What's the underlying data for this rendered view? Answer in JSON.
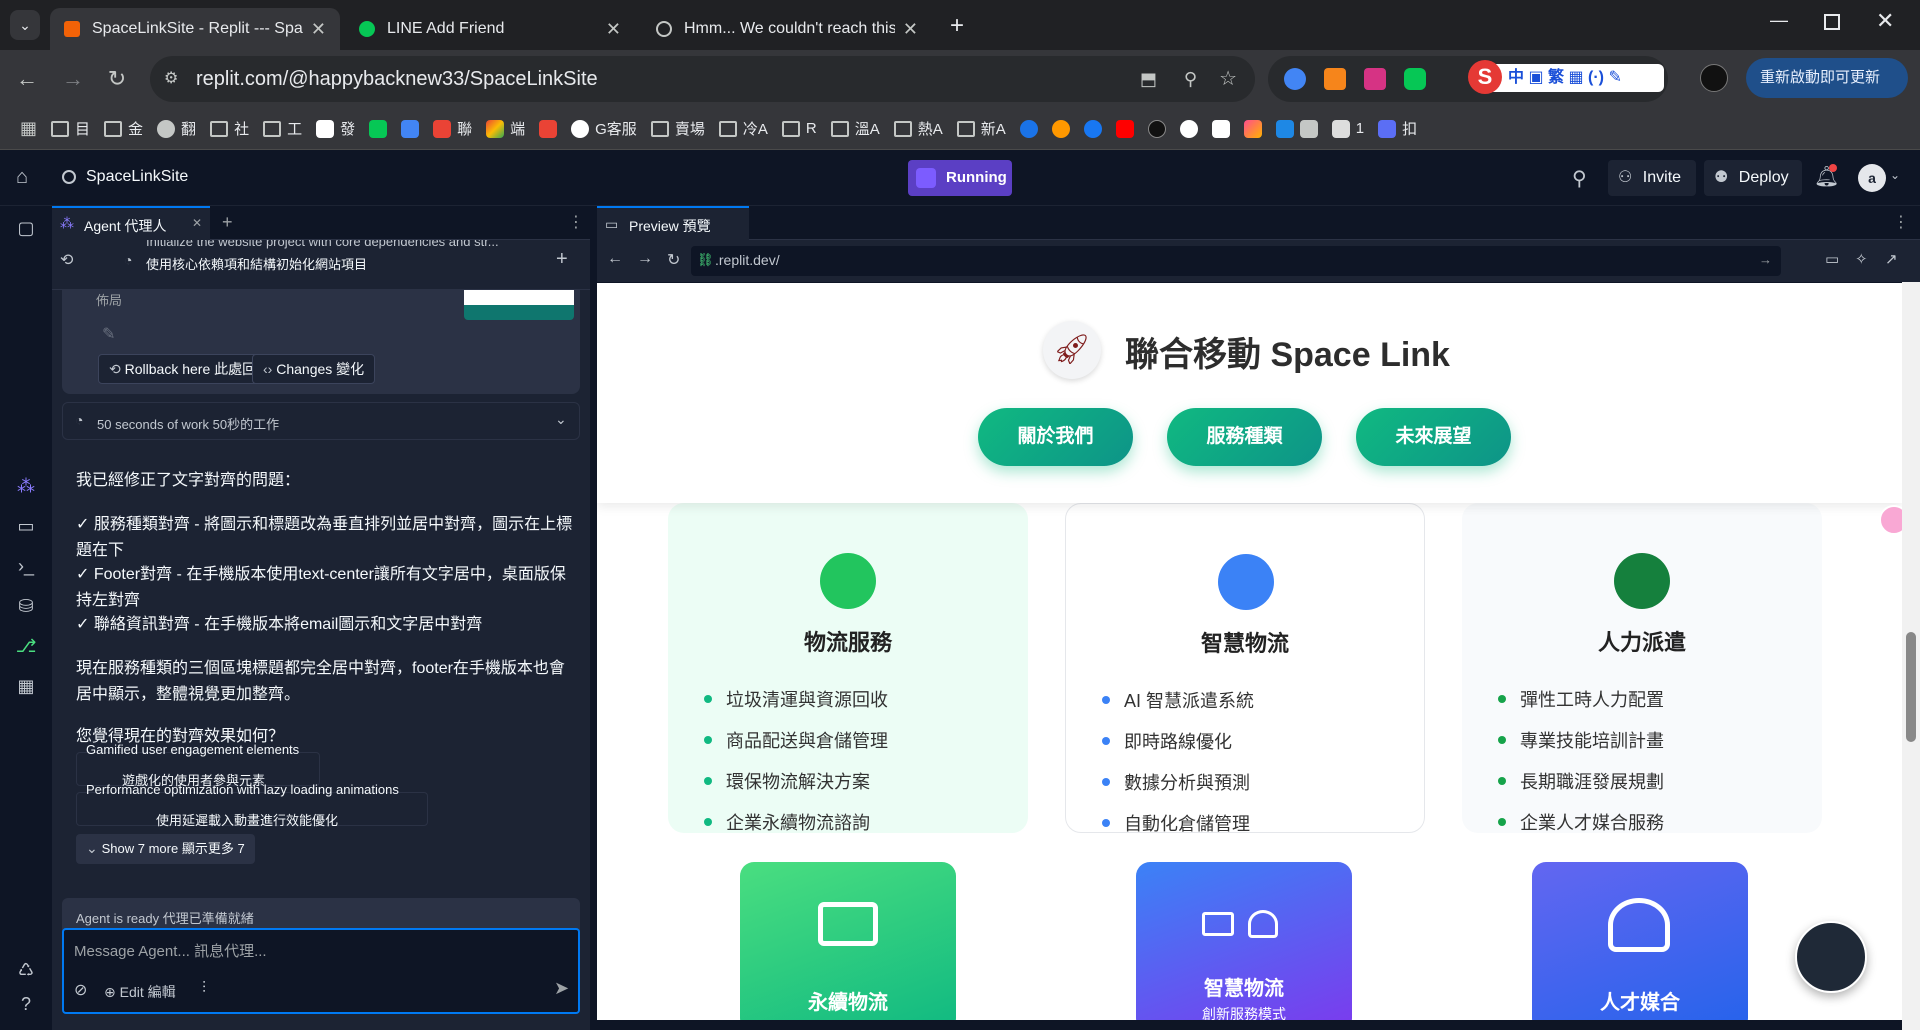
{
  "browser": {
    "tabs": [
      {
        "title": "SpaceLinkSite - Replit --- Space",
        "active": true
      },
      {
        "title": "LINE Add Friend",
        "active": false
      },
      {
        "title": "Hmm... We couldn't reach this",
        "active": false
      }
    ],
    "url": "replit.com/@happybacknew33/SpaceLinkSite",
    "update_button": "重新啟動即可更新",
    "bookmarks": [
      "目",
      "金",
      "翻",
      "社",
      "工",
      "發",
      "聯",
      "端",
      "G客服",
      "賣場",
      "冷A",
      "R",
      "溫A",
      "熱A",
      "新A",
      "1",
      "扣"
    ]
  },
  "replit": {
    "project": "SpaceLinkSite",
    "status": "Running",
    "invite": "Invite",
    "deploy": "Deploy",
    "avatar": "a"
  },
  "agent": {
    "tab_label": "Agent 代理人",
    "history_line_en": "Initialize the website project with core dependencies and str...",
    "history_line_zh": "使用核心依賴項和結構初始化網站項目",
    "partial_text": "佈局",
    "rollback": "Rollback here 此處回滾",
    "changes": "Changes 變化",
    "work_time": "50 seconds of work 50秒的工作",
    "message_lines": [
      "我已經修正了文字對齊的問題：",
      "✓ 服務種類對齊 - 將圖示和標題改為垂直排列並居中對齊，圖示在上標",
      "題在下",
      "✓ Footer對齊 - 在手機版本使用text-center讓所有文字居中，桌面版保",
      "持左對齊",
      "✓ 聯絡資訊對齊 - 在手機版本將email圖示和文字居中對齊",
      "現在服務種類的三個區塊標題都完全居中對齊，footer在手機版本也會",
      "居中顯示，整體視覺更加整齊。",
      "您覺得現在的對齊效果如何？"
    ],
    "suggestions": [
      {
        "en": "Gamified user engagement elements",
        "zh": "遊戲化的使用者參與元素"
      },
      {
        "en": "Performance optimization with lazy loading animations",
        "zh": "使用延遲載入動畫進行效能優化"
      }
    ],
    "show_more": "Show 7 more 顯示更多 7",
    "ready": "Agent is ready 代理已準備就緒",
    "input_placeholder": "Message Agent... 訊息代理...",
    "edit": "Edit 編輯"
  },
  "preview": {
    "tab_label": "Preview 預覽",
    "url": ".replit.dev/"
  },
  "site": {
    "title": "聯合移動 Space Link",
    "nav": [
      "關於我們",
      "服務種類",
      "未來展望"
    ],
    "cards": [
      {
        "title": "物流服務",
        "items": [
          "垃圾清運與資源回收",
          "商品配送與倉儲管理",
          "環保物流解決方案",
          "企業永續物流諮詢"
        ]
      },
      {
        "title": "智慧物流",
        "items": [
          "AI 智慧派遣系統",
          "即時路線優化",
          "數據分析與預測",
          "自動化倉儲管理"
        ]
      },
      {
        "title": "人力派遣",
        "items": [
          "彈性工時人力配置",
          "專業技能培訓計畫",
          "長期職涯發展規劃",
          "企業人才媒合服務"
        ]
      }
    ],
    "tiles": [
      {
        "title": "永續物流"
      },
      {
        "title": "智慧物流",
        "subtitle": "創新服務模式"
      },
      {
        "title": "人才媒合"
      }
    ],
    "colors": {
      "green": "#10b981",
      "blue": "#3b82f6",
      "darkgreen": "#16a34a",
      "purple": "#7c3aed"
    }
  }
}
